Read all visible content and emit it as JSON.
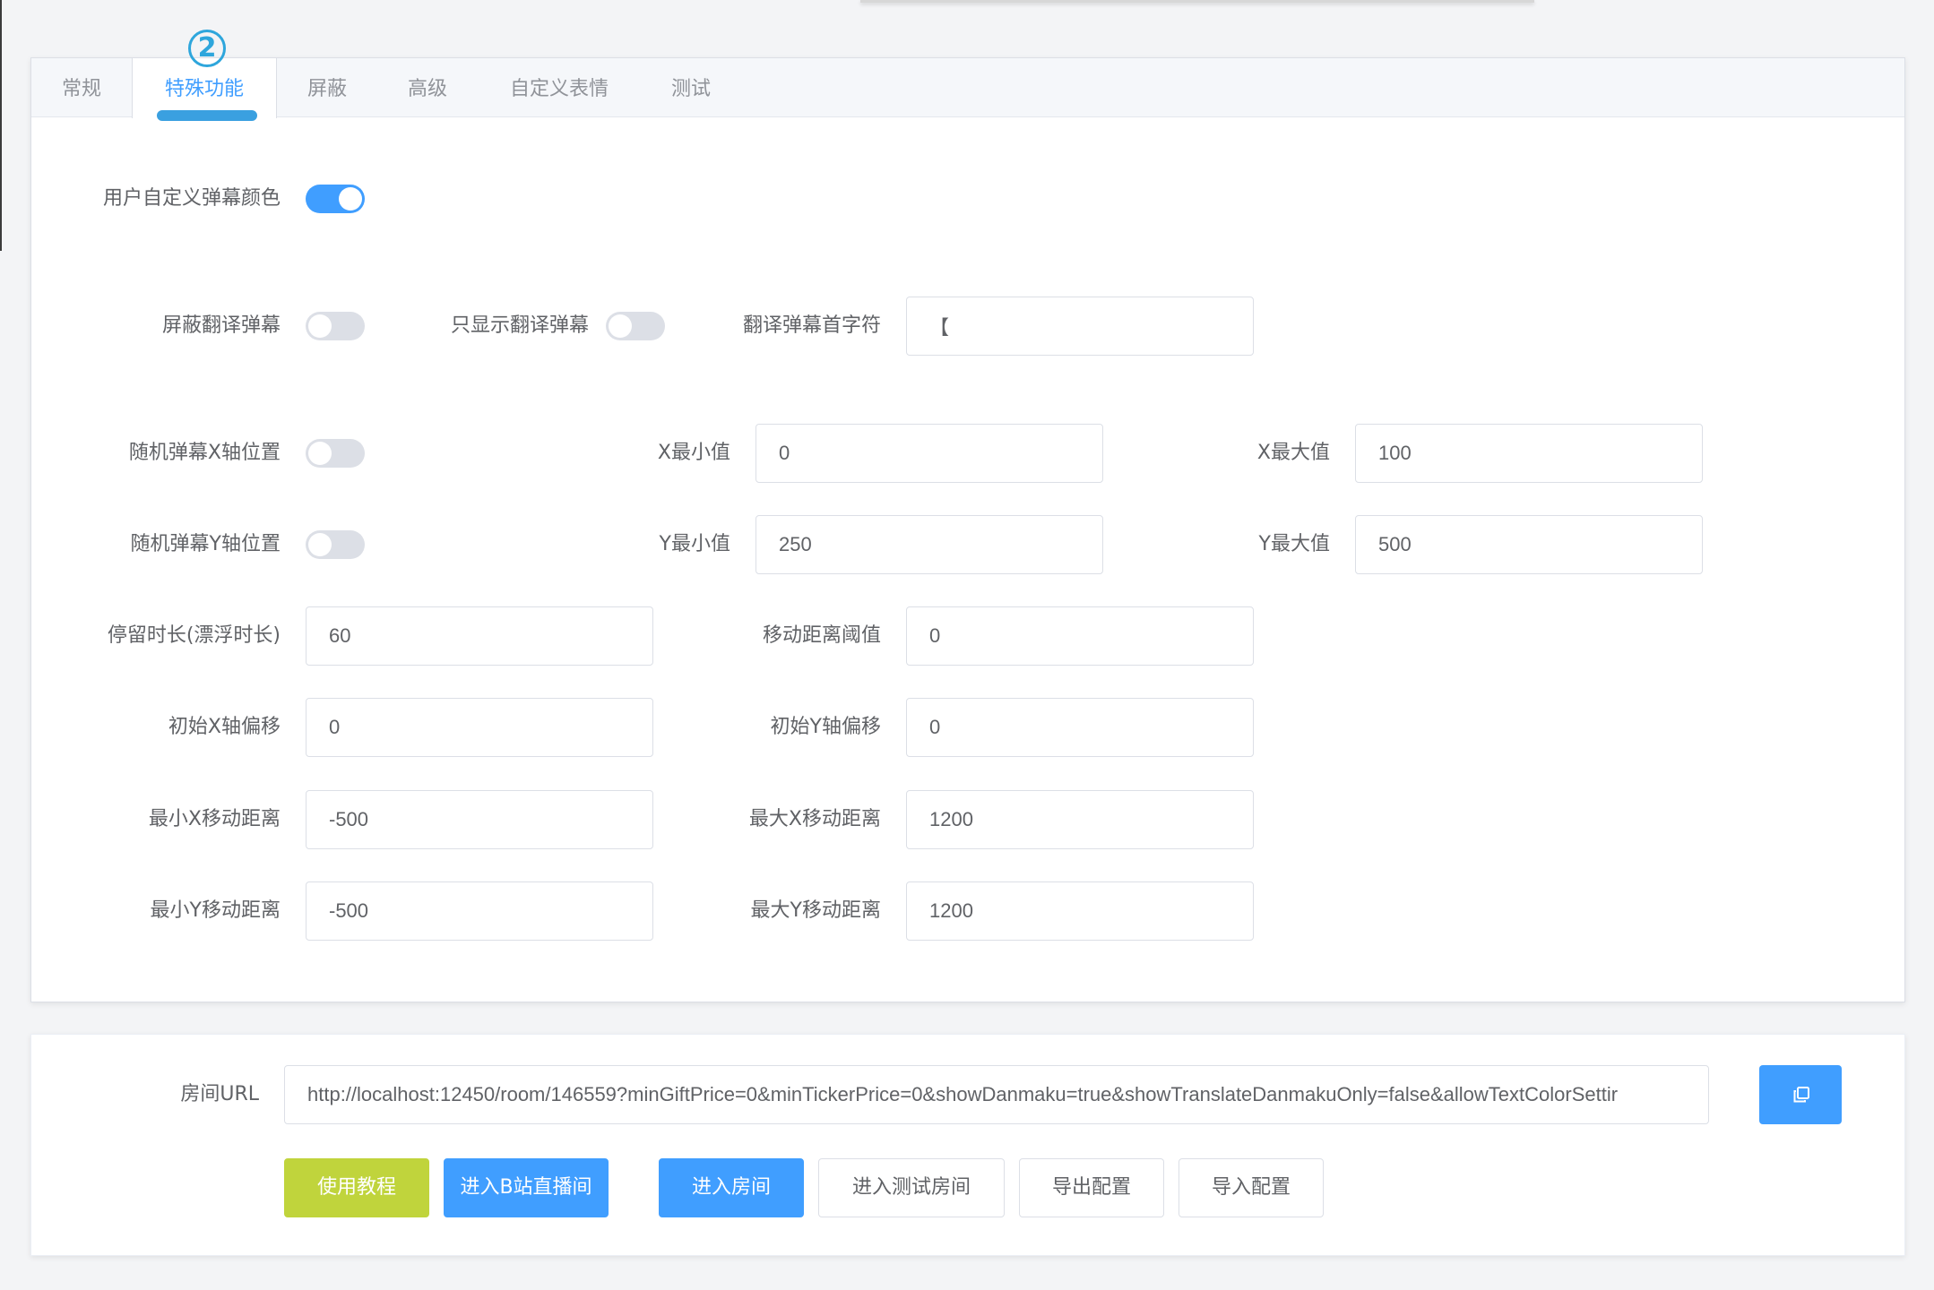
{
  "tabs": [
    {
      "label": "常规"
    },
    {
      "label": "特殊功能"
    },
    {
      "label": "屏蔽"
    },
    {
      "label": "高级"
    },
    {
      "label": "自定义表情"
    },
    {
      "label": "测试"
    }
  ],
  "active_tab": "特殊功能",
  "step_badge": "2",
  "form": {
    "custom_color": {
      "label": "用户自定义弹幕颜色",
      "enabled": true
    },
    "block_translate": {
      "label": "屏蔽翻译弹幕",
      "enabled": false
    },
    "only_translate": {
      "label": "只显示翻译弹幕",
      "enabled": false
    },
    "translate_prefix": {
      "label": "翻译弹幕首字符",
      "value": "【"
    },
    "random_x": {
      "label": "随机弹幕X轴位置",
      "enabled": false
    },
    "x_min": {
      "label": "X最小值",
      "value": "0"
    },
    "x_max": {
      "label": "X最大值",
      "value": "100"
    },
    "random_y": {
      "label": "随机弹幕Y轴位置",
      "enabled": false
    },
    "y_min": {
      "label": "Y最小值",
      "value": "250"
    },
    "y_max": {
      "label": "Y最大值",
      "value": "500"
    },
    "stay_duration": {
      "label": "停留时长(漂浮时长)",
      "value": "60"
    },
    "move_threshold": {
      "label": "移动距离阈值",
      "value": "0"
    },
    "init_x_offset": {
      "label": "初始X轴偏移",
      "value": "0"
    },
    "init_y_offset": {
      "label": "初始Y轴偏移",
      "value": "0"
    },
    "min_x_move": {
      "label": "最小X移动距离",
      "value": "-500"
    },
    "max_x_move": {
      "label": "最大X移动距离",
      "value": "1200"
    },
    "min_y_move": {
      "label": "最小Y移动距离",
      "value": "-500"
    },
    "max_y_move": {
      "label": "最大Y移动距离",
      "value": "1200"
    }
  },
  "room": {
    "label": "房间URL",
    "url": "http://localhost:12450/room/146559?minGiftPrice=0&minTickerPrice=0&showDanmaku=true&showTranslateDanmakuOnly=false&allowTextColorSettir",
    "copy_icon": "copy-icon"
  },
  "buttons": {
    "tutorial": "使用教程",
    "enter_bili": "进入B站直播间",
    "enter_room": "进入房间",
    "enter_test_room": "进入测试房间",
    "export_config": "导出配置",
    "import_config": "导入配置"
  },
  "colors": {
    "primary": "#409eff",
    "success": "#c0d43c",
    "badge": "#2ea6dc"
  }
}
